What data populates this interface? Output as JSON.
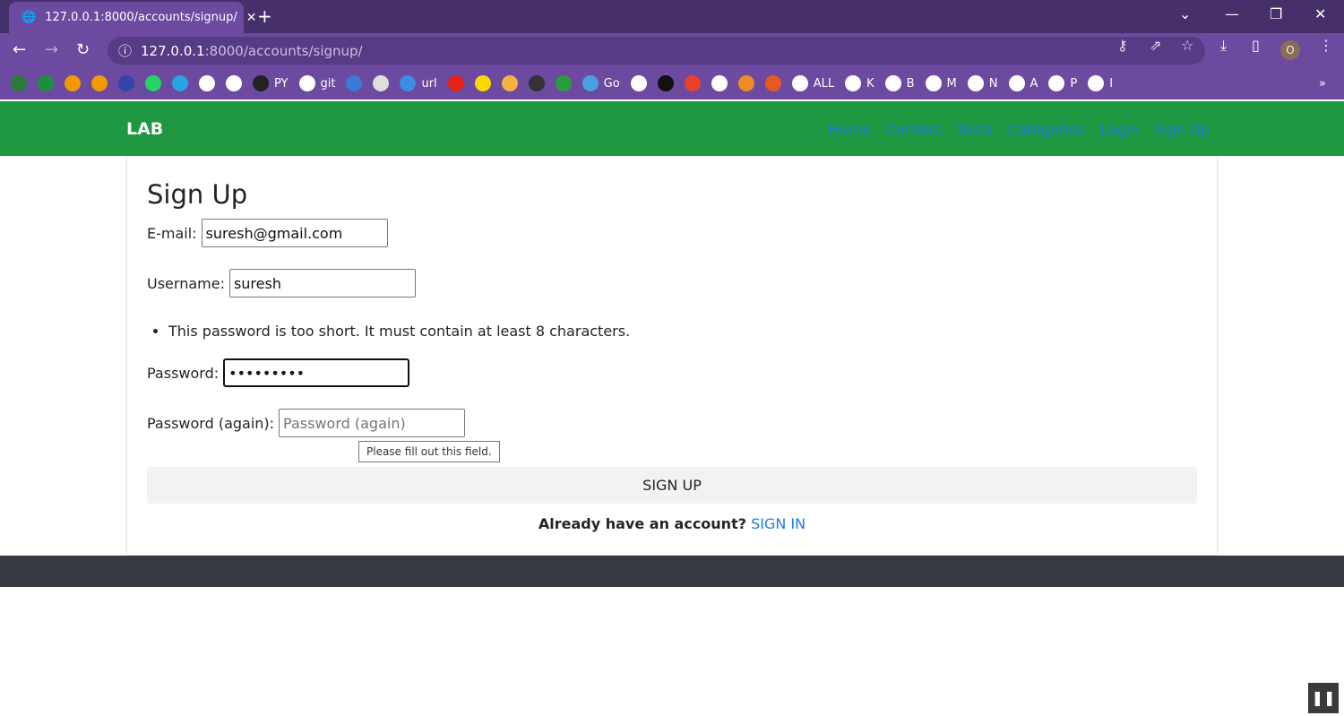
{
  "browser": {
    "tab_title": "127.0.0.1:8000/accounts/signup/",
    "url_host": "127.0.0.1",
    "url_rest": ":8000/accounts/signup/",
    "profile": "O",
    "bookmarks": [
      {
        "l": "",
        "c": "#2a7a3a"
      },
      {
        "l": "",
        "c": "#1e8e3e"
      },
      {
        "l": "",
        "c": "#f29900"
      },
      {
        "l": "",
        "c": "#f29900"
      },
      {
        "l": "",
        "c": "#3344aa"
      },
      {
        "l": "",
        "c": "#25d366"
      },
      {
        "l": "",
        "c": "#2aa3e0"
      },
      {
        "l": "",
        "c": "#fff"
      },
      {
        "l": "",
        "c": "#fff"
      },
      {
        "l": "PY",
        "c": "#222"
      },
      {
        "l": "git",
        "c": "#fff"
      },
      {
        "l": "",
        "c": "#3a7bd5"
      },
      {
        "l": "",
        "c": "#ddd"
      },
      {
        "l": "url",
        "c": "#3a8fe0"
      },
      {
        "l": "",
        "c": "#e62117"
      },
      {
        "l": "",
        "c": "#ffd600"
      },
      {
        "l": "",
        "c": "#f5b342"
      },
      {
        "l": "",
        "c": "#333"
      },
      {
        "l": "",
        "c": "#2a9d3a"
      },
      {
        "l": "Go",
        "c": "#4a9fe0"
      },
      {
        "l": "",
        "c": "#fff"
      },
      {
        "l": "",
        "c": "#111"
      },
      {
        "l": "",
        "c": "#e8412c"
      },
      {
        "l": "",
        "c": "#fff"
      },
      {
        "l": "",
        "c": "#f08a24"
      },
      {
        "l": "",
        "c": "#e55a20"
      },
      {
        "l": "ALL",
        "c": "#fff"
      },
      {
        "l": "K",
        "c": "#fff"
      },
      {
        "l": "B",
        "c": "#fff"
      },
      {
        "l": "M",
        "c": "#fff"
      },
      {
        "l": "N",
        "c": "#fff"
      },
      {
        "l": "A",
        "c": "#fff"
      },
      {
        "l": "P",
        "c": "#fff"
      },
      {
        "l": "I",
        "c": "#fff"
      }
    ]
  },
  "nav": {
    "brand": "LAB",
    "links": [
      "Home",
      "Centers",
      "Tests",
      "Categories",
      "Login",
      "Sign Up"
    ]
  },
  "form": {
    "title": "Sign Up",
    "email_label": "E-mail:",
    "email_value": "suresh@gmail.com",
    "username_label": "Username:",
    "username_value": "suresh",
    "error": "This password is too short. It must contain at least 8 characters.",
    "password_label": "Password:",
    "password_value": "•••••••••",
    "password2_label": "Password (again):",
    "password2_placeholder": "Password (again)",
    "tooltip": "Please fill out this field.",
    "submit": "SIGN UP",
    "already": "Already have an account?",
    "signin": "SIGN IN"
  }
}
